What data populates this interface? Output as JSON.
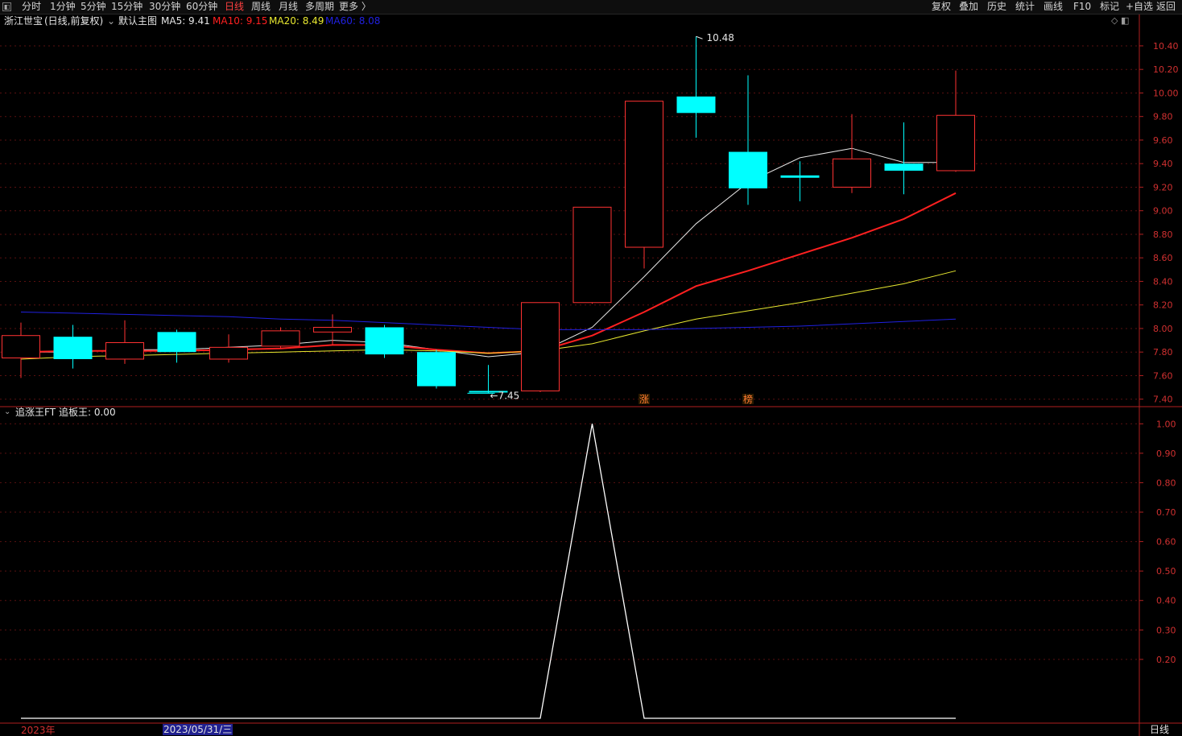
{
  "toolbar": {
    "collapse_glyph": "◧",
    "left_tabs": [
      "分时",
      "1分钟",
      "5分钟",
      "15分钟",
      "30分钟",
      "60分钟",
      "日线",
      "周线",
      "月线",
      "多周期",
      "更多 〉"
    ],
    "active_tab": "日线",
    "right_buttons": [
      "复权",
      "叠加",
      "历史",
      "统计",
      "画线",
      "F10",
      "标记",
      "+自选",
      "返回"
    ]
  },
  "main_panel": {
    "stock_name": "浙江世宝",
    "period_adjust": "(日线,前复权)",
    "template_label": "默认主图",
    "ma": [
      {
        "label": "MA5: 9.41",
        "color": "#e6e6e6"
      },
      {
        "label": "MA10: 9.15",
        "color": "#ff2020"
      },
      {
        "label": "MA20: 8.49",
        "color": "#e8e830"
      },
      {
        "label": "MA60: 8.08",
        "color": "#2020e0"
      }
    ],
    "panel_icons": "◇ ◧",
    "high_label": "10.48",
    "low_label": "7.45",
    "markers": [
      {
        "text": "涨",
        "index": 12
      },
      {
        "text": "榜",
        "index": 14
      }
    ]
  },
  "indicator_panel": {
    "name": "追涨王FT",
    "value_label": "追板王: 0.00"
  },
  "bottom": {
    "year_label": "2023年",
    "cursor_date": "2023/05/31/三",
    "period_label": "日线"
  },
  "chart_data": [
    {
      "type": "candlestick",
      "title": "浙江世宝 (日线,前复权)",
      "ylim": [
        7.35,
        10.55
      ],
      "y_ticks": [
        7.4,
        7.6,
        7.8,
        8.0,
        8.2,
        8.4,
        8.6,
        8.8,
        9.0,
        9.2,
        9.4,
        9.6,
        9.8,
        10.0,
        10.2,
        10.4
      ],
      "candles": [
        {
          "open": 7.75,
          "close": 7.94,
          "high": 8.05,
          "low": 7.58
        },
        {
          "open": 7.93,
          "close": 7.74,
          "high": 8.03,
          "low": 7.66
        },
        {
          "open": 7.74,
          "close": 7.88,
          "high": 8.07,
          "low": 7.7
        },
        {
          "open": 7.97,
          "close": 7.8,
          "high": 7.99,
          "low": 7.71
        },
        {
          "open": 7.74,
          "close": 7.84,
          "high": 7.95,
          "low": 7.71
        },
        {
          "open": 7.85,
          "close": 7.98,
          "high": 8.01,
          "low": 7.83
        },
        {
          "open": 7.97,
          "close": 8.01,
          "high": 8.12,
          "low": 7.86
        },
        {
          "open": 8.01,
          "close": 7.78,
          "high": 8.03,
          "low": 7.75
        },
        {
          "open": 7.8,
          "close": 7.51,
          "high": 7.82,
          "low": 7.49
        },
        {
          "open": 7.47,
          "close": 7.46,
          "high": 7.69,
          "low": 7.45
        },
        {
          "open": 7.47,
          "close": 8.22,
          "high": 8.22,
          "low": 7.46
        },
        {
          "open": 8.22,
          "close": 9.03,
          "high": 9.03,
          "low": 8.21
        },
        {
          "open": 8.69,
          "close": 9.93,
          "high": 9.93,
          "low": 8.51
        },
        {
          "open": 9.97,
          "close": 9.83,
          "high": 10.48,
          "low": 9.62
        },
        {
          "open": 9.5,
          "close": 9.19,
          "high": 10.15,
          "low": 9.05
        },
        {
          "open": 9.3,
          "close": 9.28,
          "high": 9.42,
          "low": 9.08
        },
        {
          "open": 9.2,
          "close": 9.44,
          "high": 9.82,
          "low": 9.15
        },
        {
          "open": 9.4,
          "close": 9.34,
          "high": 9.75,
          "low": 9.14
        },
        {
          "open": 9.34,
          "close": 9.81,
          "high": 10.19,
          "low": 9.33
        }
      ],
      "series": [
        {
          "name": "MA5",
          "color": "#e6e6e6",
          "values": [
            7.8,
            7.8,
            7.82,
            7.82,
            7.84,
            7.86,
            7.9,
            7.88,
            7.82,
            7.76,
            7.8,
            8.01,
            8.44,
            8.89,
            9.24,
            9.45,
            9.53,
            9.41,
            9.41
          ]
        },
        {
          "name": "MA10",
          "color": "#ff2020",
          "values": [
            7.8,
            7.81,
            7.81,
            7.81,
            7.82,
            7.83,
            7.86,
            7.86,
            7.82,
            7.79,
            7.81,
            7.94,
            8.14,
            8.36,
            8.49,
            8.63,
            8.77,
            8.93,
            9.15
          ]
        },
        {
          "name": "MA20",
          "color": "#e8e830",
          "values": [
            7.74,
            7.76,
            7.77,
            7.78,
            7.79,
            7.8,
            7.81,
            7.82,
            7.81,
            7.79,
            7.81,
            7.87,
            7.98,
            8.08,
            8.15,
            8.22,
            8.3,
            8.38,
            8.49
          ]
        },
        {
          "name": "MA60",
          "color": "#2020e0",
          "values": [
            8.14,
            8.13,
            8.12,
            8.11,
            8.1,
            8.08,
            8.07,
            8.05,
            8.03,
            8.01,
            7.99,
            7.99,
            7.99,
            8.0,
            8.01,
            8.02,
            8.04,
            8.06,
            8.08
          ]
        }
      ]
    },
    {
      "type": "line",
      "title": "追涨王FT",
      "ylim": [
        0,
        1.05
      ],
      "y_ticks": [
        0.2,
        0.3,
        0.4,
        0.5,
        0.6,
        0.7,
        0.8,
        0.9,
        1.0
      ],
      "series": [
        {
          "name": "追板王",
          "color": "#ffffff",
          "values": [
            0,
            0,
            0,
            0,
            0,
            0,
            0,
            0,
            0,
            0,
            0,
            1,
            0,
            0,
            0,
            0,
            0,
            0,
            0
          ]
        }
      ]
    }
  ]
}
